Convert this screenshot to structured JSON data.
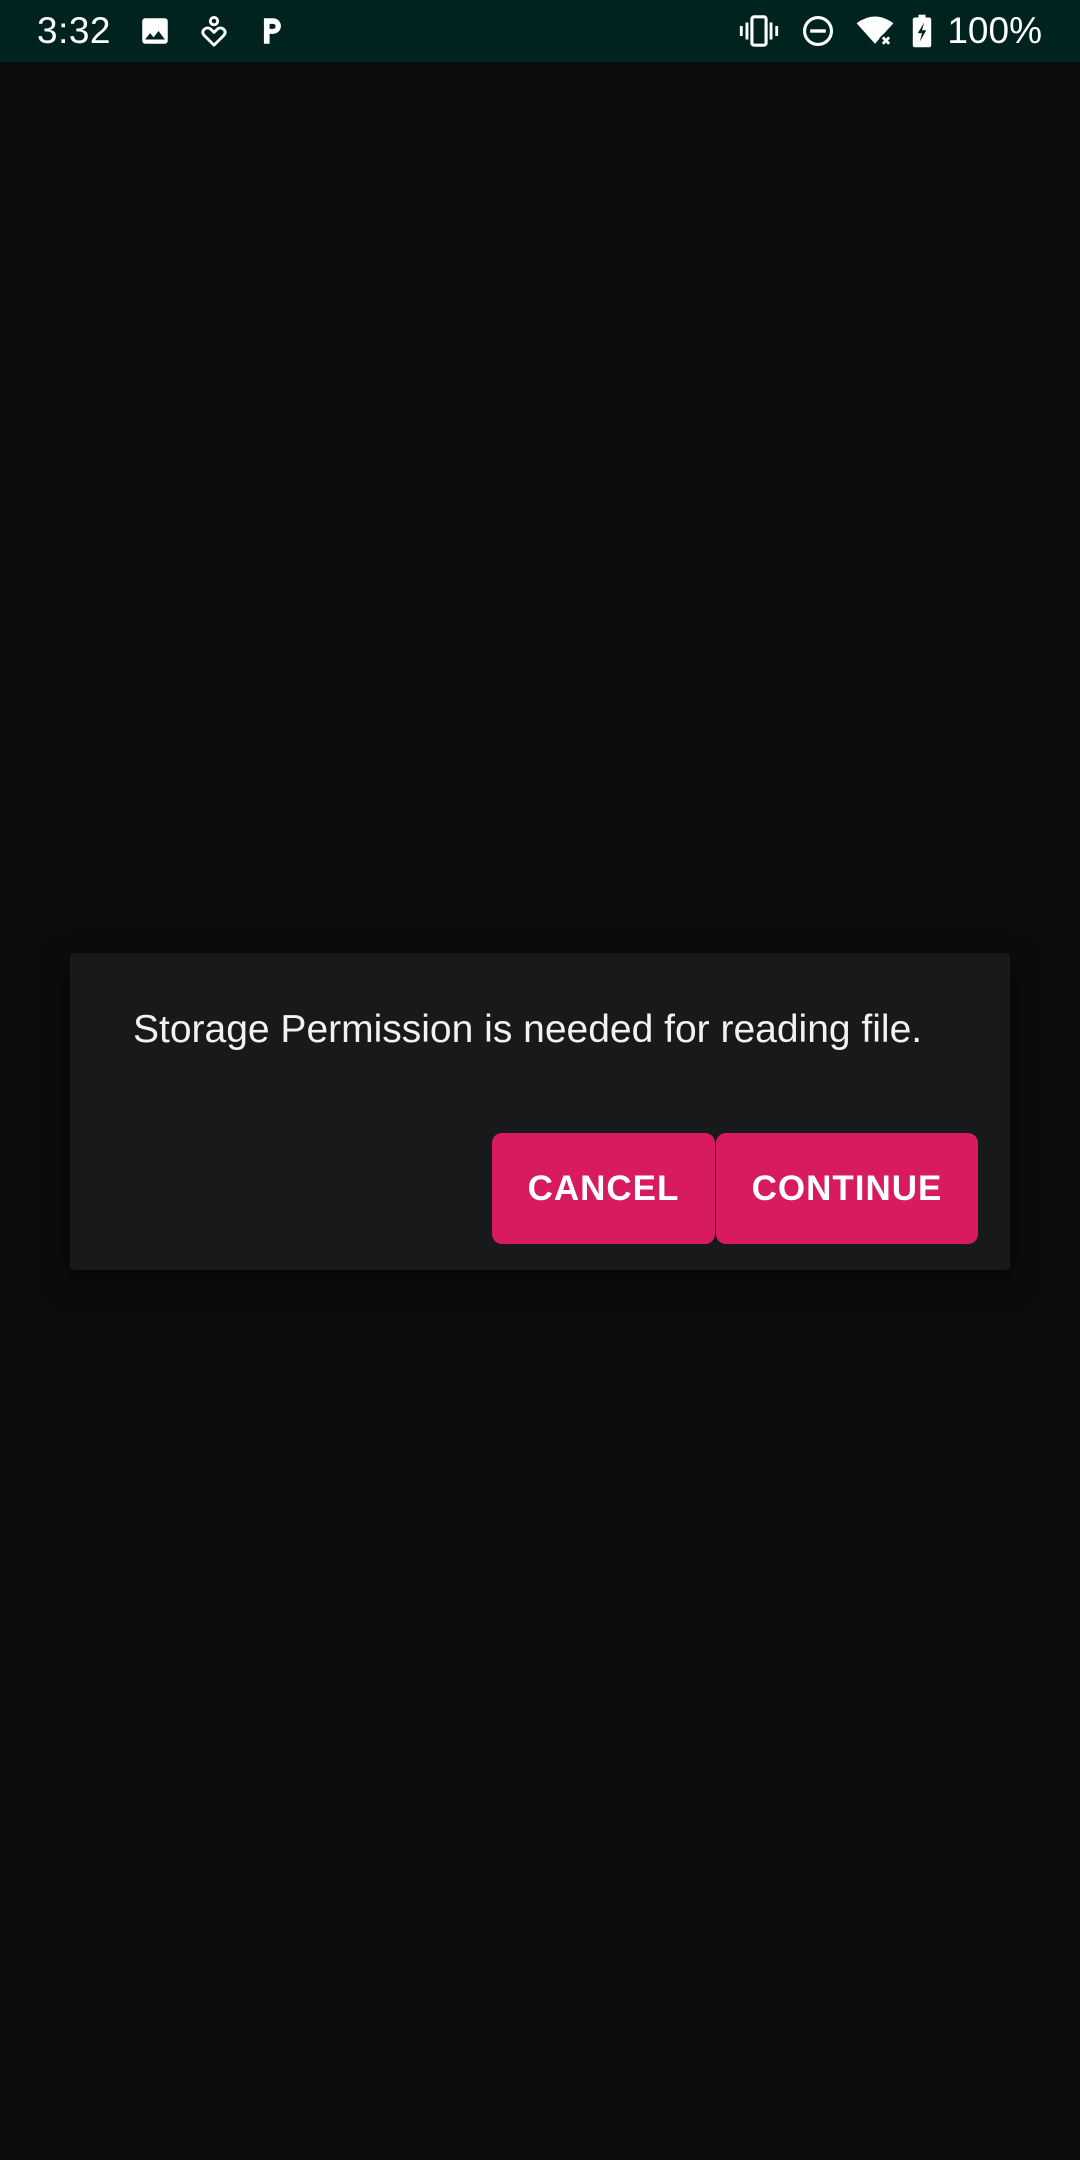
{
  "status_bar": {
    "time": "3:32",
    "left_icons": [
      "image-icon",
      "location-heart-icon",
      "parking-p-icon"
    ],
    "right_icons": [
      "vibrate-icon",
      "do-not-disturb-icon",
      "wifi-no-internet-icon",
      "battery-charging-icon"
    ],
    "battery": "100%",
    "background": "#002320"
  },
  "dialog": {
    "message": "Storage Permission is needed for reading file.",
    "cancel_label": "CANCEL",
    "continue_label": "CONTINUE",
    "accent_color": "#d81b60",
    "background": "#18191b"
  },
  "screen_background": "#0b0c0e"
}
